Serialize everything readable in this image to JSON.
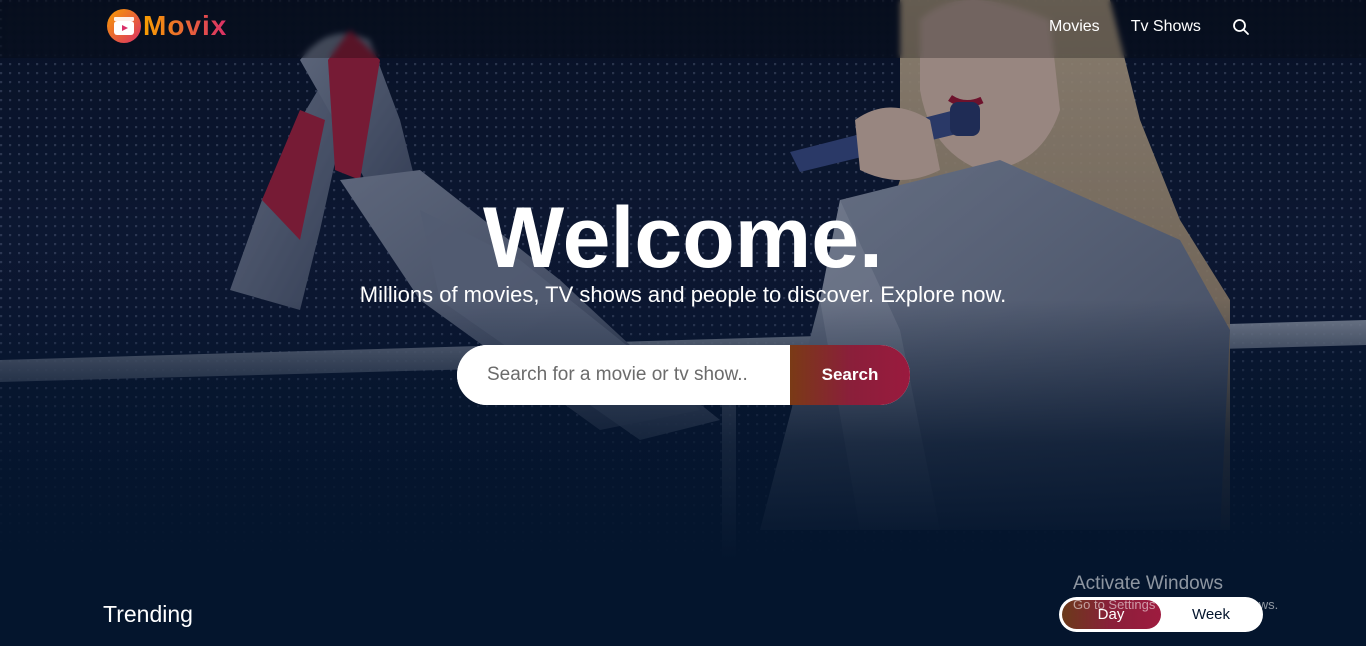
{
  "header": {
    "logo_text": "Movix",
    "nav": {
      "movies_label": "Movies",
      "tv_label": "Tv Shows"
    }
  },
  "hero": {
    "title": "Welcome.",
    "subtitle": "Millions of movies, TV shows and people to discover. Explore now.",
    "search": {
      "placeholder": "Search for a movie or tv show..",
      "button_label": "Search"
    }
  },
  "trending": {
    "title": "Trending",
    "tabs": [
      "Day",
      "Week"
    ],
    "active_tab": "Day"
  },
  "watermark": {
    "title": "Activate Windows",
    "subtitle": "Go to Settings to activate Windows."
  },
  "colors": {
    "background": "#04152d",
    "accent_orange": "#f89e00",
    "accent_pink": "#da2f68"
  },
  "icons": {
    "logo": "film-reel-icon",
    "search": "search-icon"
  }
}
